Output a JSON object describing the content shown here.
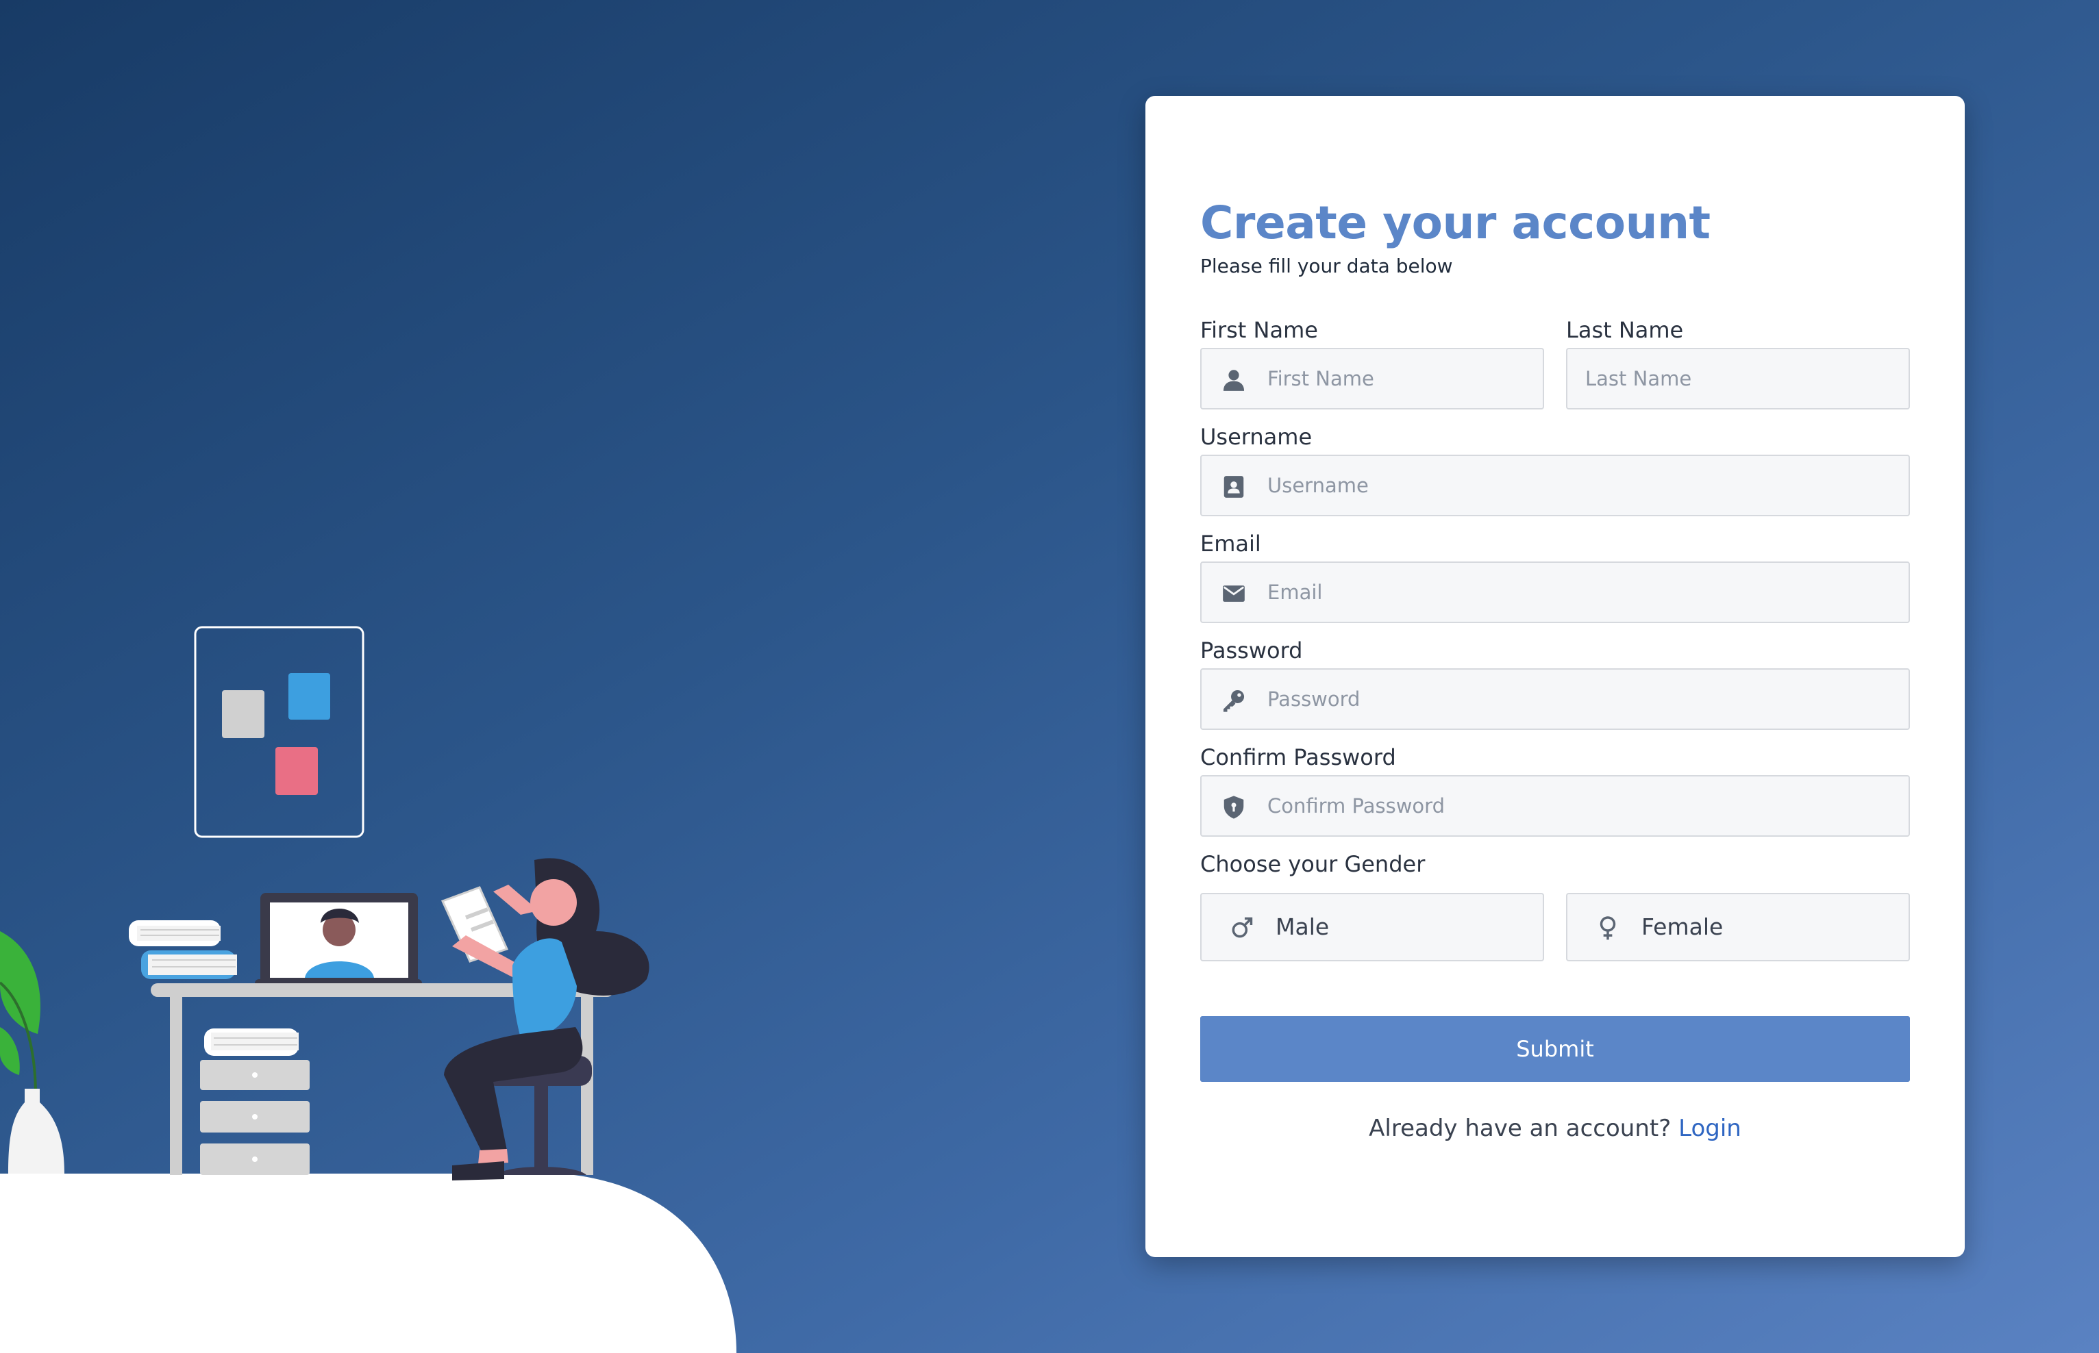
{
  "colors": {
    "accent": "#5b86c8",
    "link": "#2f66c2",
    "card_bg": "#ffffff",
    "input_bg": "#f6f7f9"
  },
  "form": {
    "title": "Create your account",
    "subtitle": "Please fill your data below",
    "first_name": {
      "label": "First Name",
      "placeholder": "First Name",
      "value": "",
      "icon": "user-icon"
    },
    "last_name": {
      "label": "Last Name",
      "placeholder": "Last Name",
      "value": ""
    },
    "username": {
      "label": "Username",
      "placeholder": "Username",
      "value": "",
      "icon": "id-badge-icon"
    },
    "email": {
      "label": "Email",
      "placeholder": "Email",
      "value": "",
      "icon": "envelope-icon"
    },
    "password": {
      "label": "Password",
      "placeholder": "Password",
      "value": "",
      "icon": "key-icon"
    },
    "confirm_password": {
      "label": "Confirm Password",
      "placeholder": "Confirm Password",
      "value": "",
      "icon": "shield-icon"
    },
    "gender": {
      "label": "Choose your Gender",
      "options": [
        {
          "label": "Male",
          "icon": "male-symbol-icon"
        },
        {
          "label": "Female",
          "icon": "female-symbol-icon"
        }
      ]
    },
    "submit_label": "Submit",
    "footer_text": "Already have an account?",
    "login_link": "Login"
  }
}
